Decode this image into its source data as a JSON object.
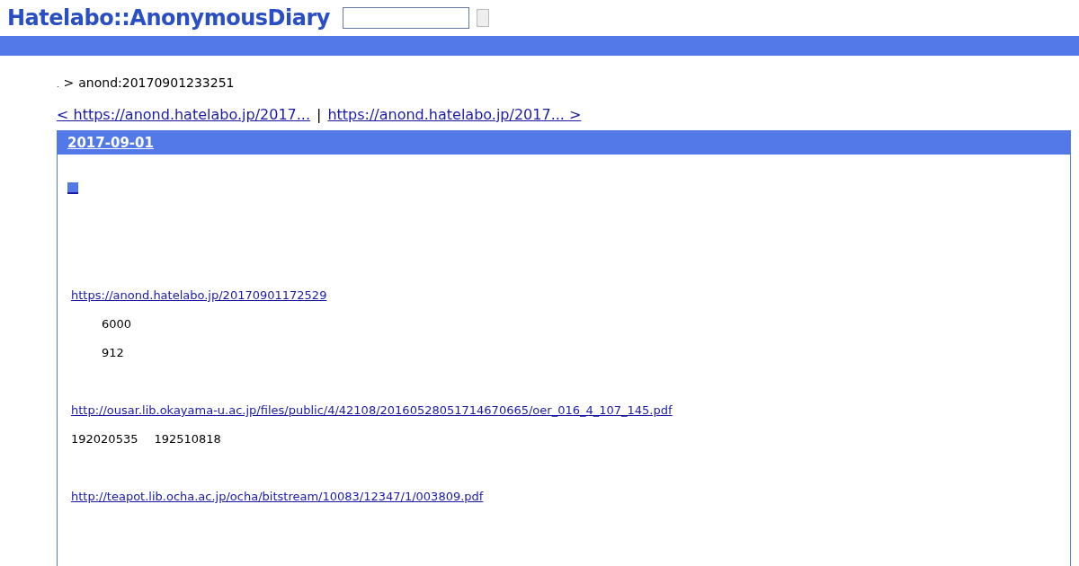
{
  "header": {
    "logo": "Hatelabo::AnonymousDiary"
  },
  "breadcrumb": {
    "prefix": ".",
    "separator": ">",
    "current": "anond:20170901233251"
  },
  "nav": {
    "prev": "< https://anond.hatelabo.jp/2017...",
    "divider": "|",
    "next": "https://anond.hatelabo.jp/2017... >"
  },
  "day": {
    "date": "2017-09-01",
    "body": [
      {
        "kind": "link",
        "text": "https://anond.hatelabo.jp/20170901172529"
      },
      {
        "kind": "indent",
        "text": "6000"
      },
      {
        "kind": "indent",
        "text": "912"
      },
      {
        "kind": "gap"
      },
      {
        "kind": "link",
        "text": "http://ousar.lib.okayama-u.ac.jp/files/public/4/42108/20160528051714670665/oer_016_4_107_145.pdf"
      },
      {
        "kind": "words",
        "parts": [
          "192020535",
          "192510818"
        ]
      },
      {
        "kind": "gap"
      },
      {
        "kind": "link",
        "text": "http://teapot.lib.ocha.ac.jp/ocha/bitstream/10083/12347/1/003809.pdf"
      }
    ]
  }
}
